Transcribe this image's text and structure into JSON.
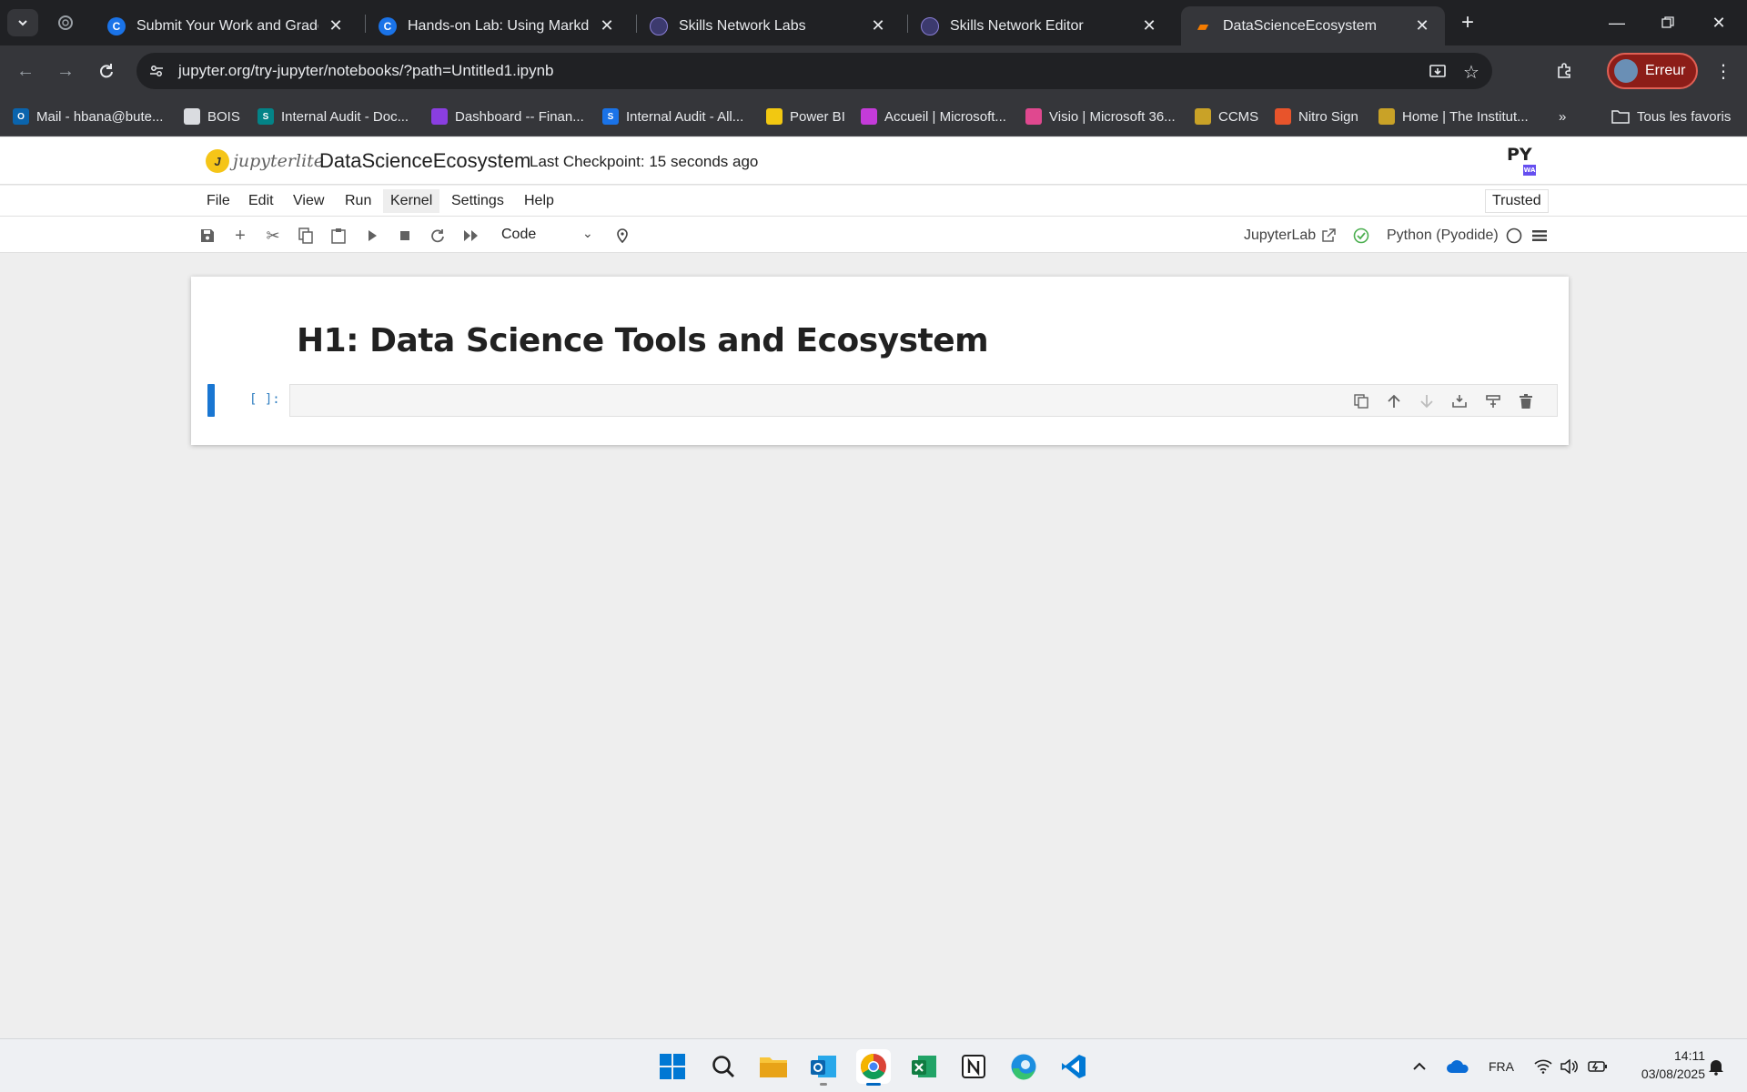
{
  "browser": {
    "tabs": [
      {
        "title": "Submit Your Work and Grade Yo",
        "favicon": "coursera-icon"
      },
      {
        "title": "Hands-on Lab: Using Markdow",
        "favicon": "coursera-icon"
      },
      {
        "title": "Skills Network Labs",
        "favicon": "skills-network-icon"
      },
      {
        "title": "Skills Network Editor",
        "favicon": "skills-network-icon"
      },
      {
        "title": "DataScienceEcosystem",
        "favicon": "jupyter-book-icon",
        "active": true
      }
    ],
    "url": "jupyter.org/try-jupyter/notebooks/?path=Untitled1.ipynb",
    "profile_label": "Erreur",
    "bookmarks": [
      {
        "label": "Mail - hbana@bute...",
        "icon": "outlook-icon",
        "color": "#0a64ad"
      },
      {
        "label": "BOIS",
        "icon": "document-icon",
        "color": "#dadce0"
      },
      {
        "label": "Internal Audit - Doc...",
        "icon": "sharepoint-icon",
        "color": "#038387"
      },
      {
        "label": "Dashboard -- Finan...",
        "icon": "powerapps-icon",
        "color": "#8a3ee0"
      },
      {
        "label": "Internal Audit - All...",
        "icon": "sharepoint-icon",
        "color": "#1a73e8"
      },
      {
        "label": "Power BI",
        "icon": "powerbi-icon",
        "color": "#f2c811"
      },
      {
        "label": "Accueil | Microsoft...",
        "icon": "microsoft365-icon",
        "color": "#c43bd9"
      },
      {
        "label": "Visio | Microsoft 36...",
        "icon": "microsoft365-icon",
        "color": "#e0488f"
      },
      {
        "label": "CCMS",
        "icon": "ccms-icon",
        "color": "#c9a227"
      },
      {
        "label": "Nitro Sign",
        "icon": "nitro-icon",
        "color": "#e8542b"
      },
      {
        "label": "Home | The Institut...",
        "icon": "institute-icon",
        "color": "#c9a227"
      }
    ],
    "all_bookmarks_label": "Tous les favoris"
  },
  "jupyter": {
    "logo_text": "jupyterlite",
    "notebook_title": "DataScienceEcosystem",
    "checkpoint": "Last Checkpoint: 15 seconds ago",
    "menu": [
      "File",
      "Edit",
      "View",
      "Run",
      "Kernel",
      "Settings",
      "Help"
    ],
    "trusted": "Trusted",
    "cell_type": "Code",
    "jupyterlab_link": "JupyterLab",
    "kernel_name": "Python (Pyodide)",
    "cells": {
      "markdown_heading": "H1: Data Science Tools and Ecosystem",
      "code_prompt": "[ ]:"
    }
  },
  "taskbar": {
    "language": "FRA",
    "time": "14:11",
    "date": "03/08/2025"
  },
  "colors": {
    "accent": "#1976d2",
    "chrome_dark": "#202124",
    "chrome_mid": "#35363a",
    "kernel_ok": "#4caf50"
  }
}
